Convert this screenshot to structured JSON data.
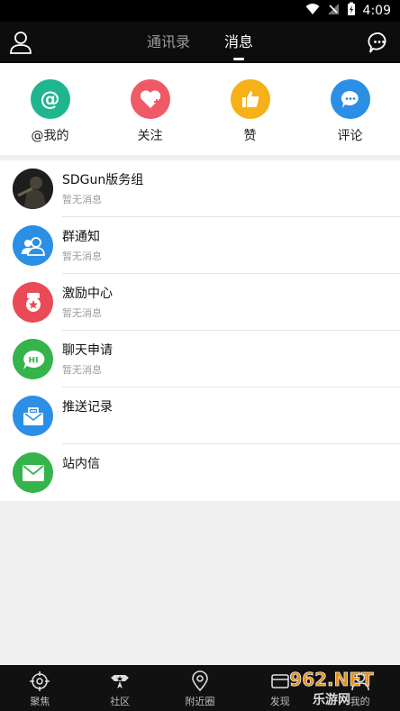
{
  "status_bar": {
    "time": "4:09"
  },
  "header": {
    "tabs": [
      {
        "label": "通讯录",
        "active": false
      },
      {
        "label": "消息",
        "active": true
      }
    ]
  },
  "quick_actions": [
    {
      "label": "@我的",
      "icon": "at-icon",
      "color": "#1fb58f"
    },
    {
      "label": "关注",
      "icon": "heart-plus-icon",
      "color": "#ee5a66"
    },
    {
      "label": "赞",
      "icon": "thumbs-up-icon",
      "color": "#f5b117"
    },
    {
      "label": "评论",
      "icon": "comment-icon",
      "color": "#2b8fe6"
    }
  ],
  "messages": [
    {
      "title": "SDGun版务组",
      "subtitle": "暂无消息",
      "icon": "user-photo-avatar",
      "color": "#2b2b2b"
    },
    {
      "title": "群通知",
      "subtitle": "暂无消息",
      "icon": "group-icon",
      "color": "#2b8fe6"
    },
    {
      "title": "激励中心",
      "subtitle": "暂无消息",
      "icon": "medal-icon",
      "color": "#ea4a55"
    },
    {
      "title": "聊天申请",
      "subtitle": "暂无消息",
      "icon": "hi-bubble-icon",
      "color": "#34b44a"
    },
    {
      "title": "推送记录",
      "subtitle": "",
      "icon": "inbox-icon",
      "color": "#2b8fe6"
    },
    {
      "title": "站内信",
      "subtitle": "",
      "icon": "mail-icon",
      "color": "#34b44a"
    }
  ],
  "bottom_nav": [
    {
      "label": "聚焦",
      "icon": "crosshair-icon"
    },
    {
      "label": "社区",
      "icon": "community-icon"
    },
    {
      "label": "附近圈",
      "icon": "location-icon"
    },
    {
      "label": "发现",
      "icon": "discover-icon"
    },
    {
      "label": "我的",
      "icon": "profile-icon"
    }
  ],
  "watermark": {
    "text": "962.NET 乐游网"
  }
}
